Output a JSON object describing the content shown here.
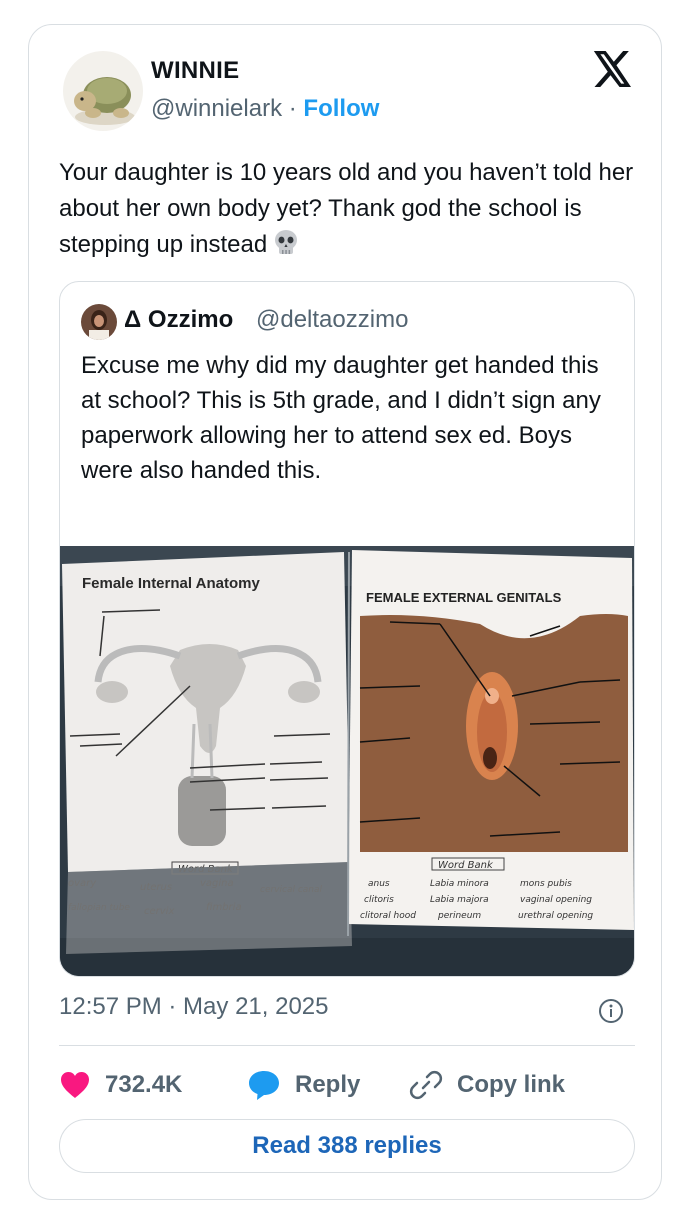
{
  "tweet": {
    "author_name": "WINNIE",
    "handle": "@winnielark",
    "separator": " · ",
    "follow_label": "Follow",
    "text": "Your daughter is 10 years old and you haven’t told her about her own body yet? Thank god the school is stepping up instead",
    "emoji": "skull-emoji",
    "timestamp": "12:57 PM · May 21, 2025",
    "likes": "732.4K",
    "reply_label": "Reply",
    "copy_link_label": "Copy link",
    "read_replies_label": "Read 388 replies"
  },
  "quoted": {
    "author_name": "Δ Ozzimo",
    "handle": "@deltaozzimo",
    "text": "Excuse me why did my daughter get handed this at school? This is 5th grade, and I didn’t sign any paperwork allowing her to attend sex ed. Boys were also handed this."
  },
  "worksheet": {
    "left_title": "Female Internal Anatomy",
    "left_word_bank_title": "Word Bank",
    "left_words": [
      "ovary",
      "uterus",
      "vagina",
      "cervical canal",
      "fallopian tube",
      "cervix",
      "fimbria"
    ],
    "right_title": "FEMALE EXTERNAL GENITALS",
    "right_word_bank_title": "Word Bank",
    "right_words": [
      "anus",
      "Labia minora",
      "mons pubis",
      "clitoris",
      "Labia majora",
      "vaginal opening",
      "clitoral hood",
      "perineum",
      "urethral opening"
    ]
  },
  "icons": [
    "x-logo",
    "heart-icon",
    "reply-icon",
    "link-icon",
    "info-icon"
  ],
  "colors": {
    "accent": "#1d9bf0",
    "like": "#f91880",
    "muted": "#536471",
    "border": "#d9dee2"
  }
}
